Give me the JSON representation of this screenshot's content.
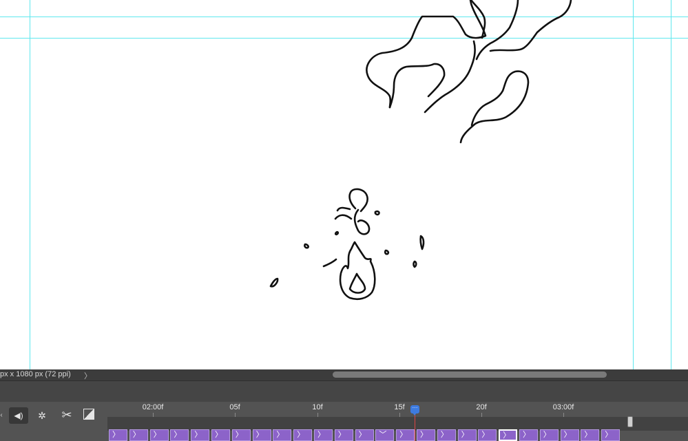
{
  "document": {
    "status_text": "px x 1080 px (72 ppi)",
    "status_arrow": "〉"
  },
  "timeline": {
    "controls": {
      "left_edge_icon": "chevron-left-icon",
      "audio_icon": "◀)",
      "gear_icon": "✲",
      "scissors_icon": "✂",
      "fade_icon": "fade-transition-icon"
    },
    "ruler_labels": [
      "02:00f",
      "05f",
      "10f",
      "15f",
      "20f",
      "03:00f"
    ],
    "frame_glyph": "〉",
    "frame_glyph_expanded": "﹀",
    "frame_count": 25,
    "current_frame": 16,
    "playhead_icon": "···",
    "colors": {
      "frame_fill": "#8c63c9",
      "playhead": "#3d7be0",
      "playhead_line": "#e04545",
      "guide": "#5ee8ee"
    }
  }
}
